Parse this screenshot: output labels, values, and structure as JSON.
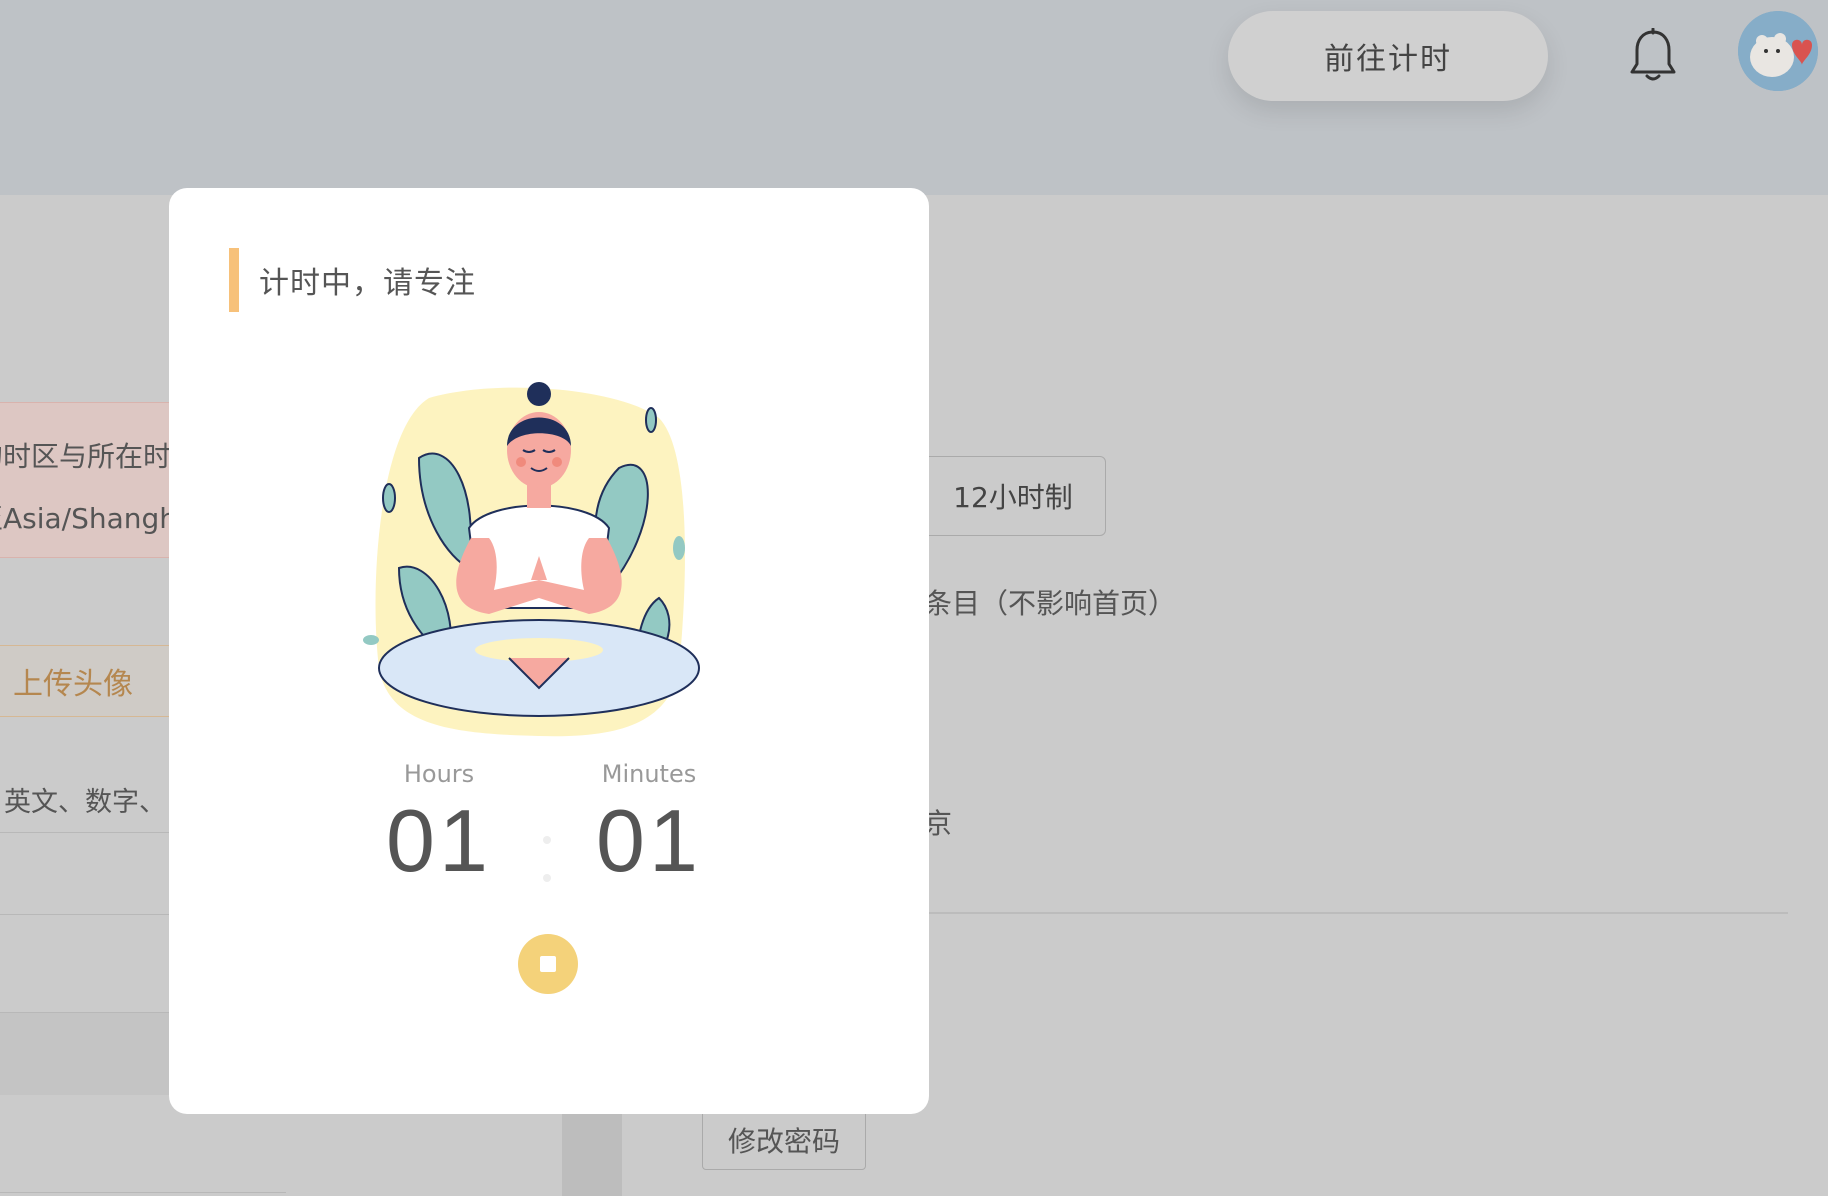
{
  "header": {
    "goto_timer_label": "前往计时",
    "icons": {
      "notifications": "bell-icon",
      "user": "avatar"
    }
  },
  "background": {
    "timezone_alert": {
      "line1": "的时区与所在时",
      "line2": "至Asia/Shanghai"
    },
    "upload_avatar_label": "上传头像",
    "password_hint": "英文、数字、",
    "hour_format_label": "12小时制",
    "items_text": "条目（不影响首页）",
    "jing_text": "京",
    "change_password_label": "修改密码"
  },
  "modal": {
    "title": "计时中，请专注",
    "hours_label": "Hours",
    "minutes_label": "Minutes",
    "hours_value": "01",
    "minutes_value": "01",
    "stop_icon": "stop-icon",
    "accent_color": "#f7c17a",
    "button_color": "#f4d27a"
  }
}
